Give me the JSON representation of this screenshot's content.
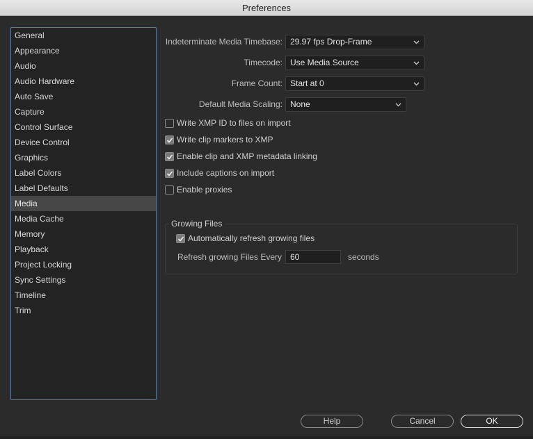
{
  "window": {
    "title": "Preferences"
  },
  "sidebar": {
    "items": [
      {
        "label": "General"
      },
      {
        "label": "Appearance"
      },
      {
        "label": "Audio"
      },
      {
        "label": "Audio Hardware"
      },
      {
        "label": "Auto Save"
      },
      {
        "label": "Capture"
      },
      {
        "label": "Control Surface"
      },
      {
        "label": "Device Control"
      },
      {
        "label": "Graphics"
      },
      {
        "label": "Label Colors"
      },
      {
        "label": "Label Defaults"
      },
      {
        "label": "Media",
        "selected": true
      },
      {
        "label": "Media Cache"
      },
      {
        "label": "Memory"
      },
      {
        "label": "Playback"
      },
      {
        "label": "Project Locking"
      },
      {
        "label": "Sync Settings"
      },
      {
        "label": "Timeline"
      },
      {
        "label": "Trim"
      }
    ]
  },
  "media": {
    "timebase_label": "Indeterminate Media Timebase:",
    "timebase_value": "29.97 fps Drop-Frame",
    "timecode_label": "Timecode:",
    "timecode_value": "Use Media Source",
    "frame_count_label": "Frame Count:",
    "frame_count_value": "Start at 0",
    "scaling_label": "Default Media Scaling:",
    "scaling_value": "None",
    "checkboxes": [
      {
        "label": "Write XMP ID to files on import",
        "checked": false
      },
      {
        "label": "Write clip markers to XMP",
        "checked": true
      },
      {
        "label": "Enable clip and XMP metadata linking",
        "checked": true
      },
      {
        "label": "Include captions on import",
        "checked": true
      },
      {
        "label": "Enable proxies",
        "checked": false
      }
    ],
    "growing": {
      "title": "Growing Files",
      "auto_refresh_label": "Automatically refresh growing files",
      "auto_refresh_checked": true,
      "refresh_every_label": "Refresh growing Files Every",
      "refresh_every_value": "60",
      "seconds_label": "seconds"
    }
  },
  "footer": {
    "help_label": "Help",
    "cancel_label": "Cancel",
    "ok_label": "OK"
  },
  "colors": {
    "background": "#2b2b2b",
    "sidebar_border": "#4a7fd4",
    "selected_item": "#464646"
  }
}
